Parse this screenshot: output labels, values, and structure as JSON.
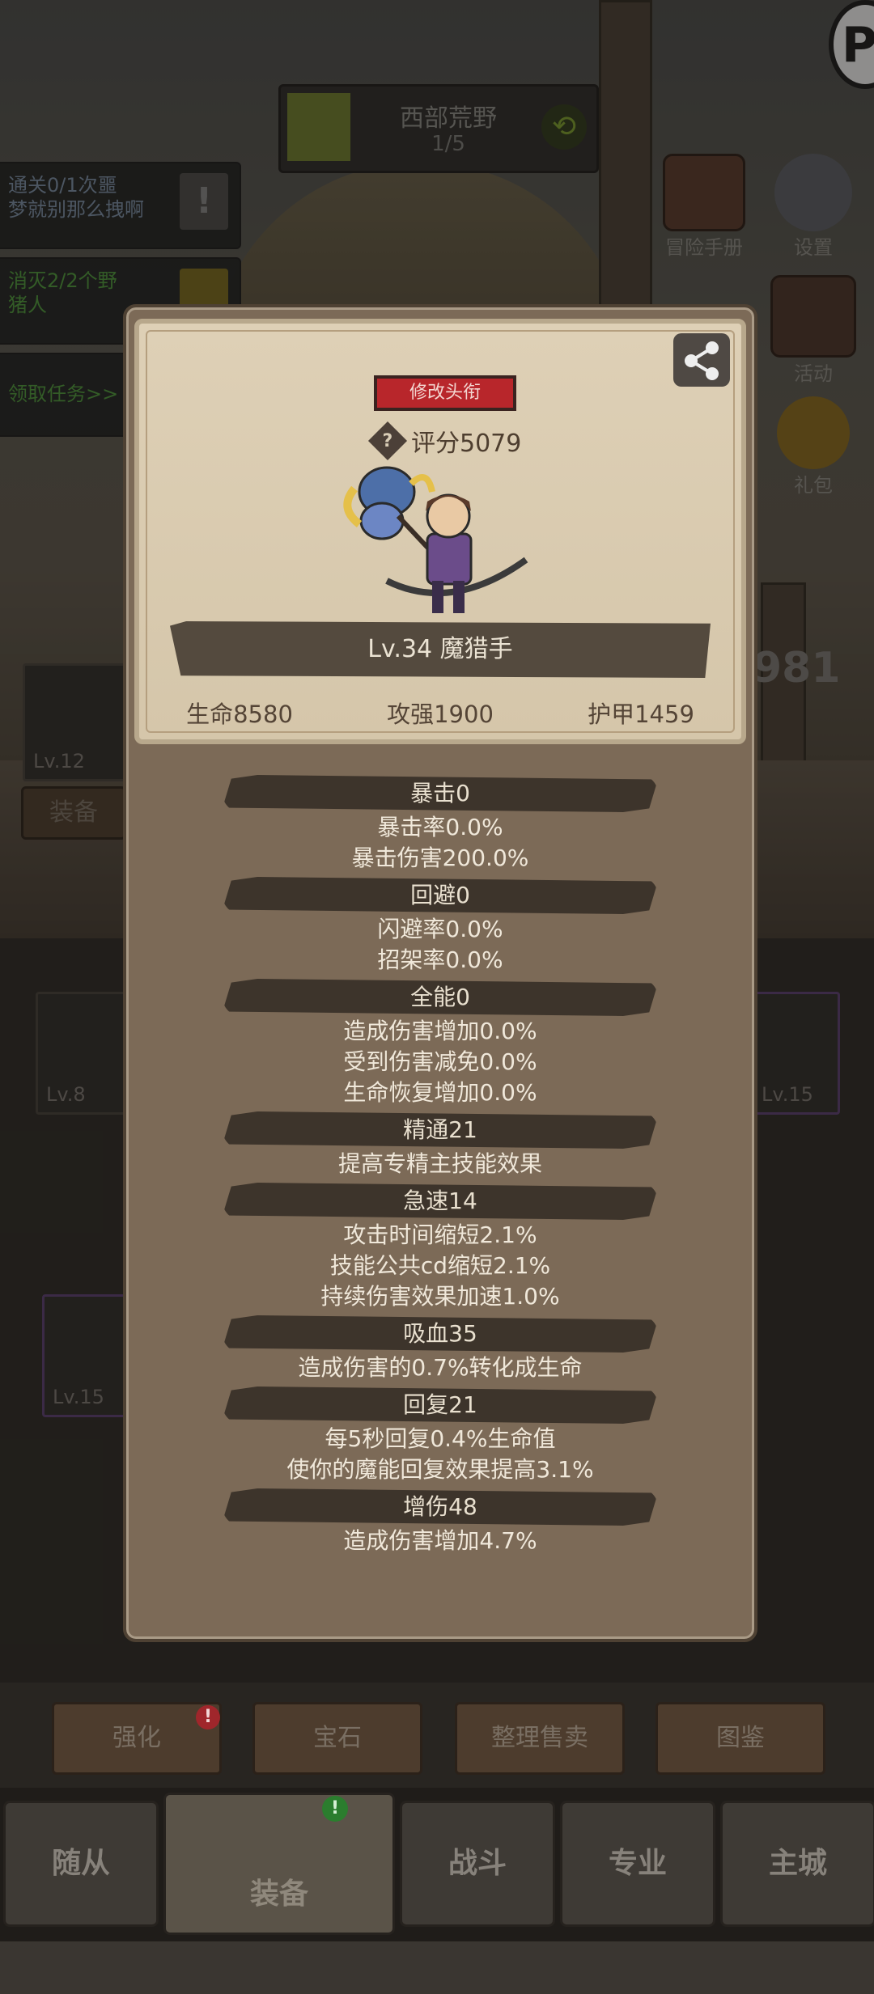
{
  "stage": {
    "name": "西部荒野",
    "progress": "1/5"
  },
  "quests": [
    {
      "line1": "通关0/1次噩",
      "line2": "梦就别那么拽啊",
      "color": "#7b8fa6",
      "button": "!"
    },
    {
      "line1": "消灭2/2个野",
      "line2": "猪人",
      "color": "#4e9a3b",
      "button": ""
    },
    {
      "line1": "领取任务>>",
      "line2": "",
      "color": "#4e9a3b",
      "button": ""
    }
  ],
  "side_menu": [
    {
      "label": "冒险手册",
      "icon": "book-icon"
    },
    {
      "label": "设置",
      "icon": "gear-icon"
    },
    {
      "label": "活动",
      "icon": "calendar-icon"
    },
    {
      "label": "礼包",
      "icon": "gift-coin-icon"
    }
  ],
  "corner_badge": "P",
  "background": {
    "score_fragment": "981",
    "equip_tab": "装备",
    "slot_levels": [
      "Lv.12",
      "Lv.8",
      "Lv.15",
      "Lv.15"
    ]
  },
  "profile": {
    "change_title_button": "修改头衔",
    "score": "评分5079",
    "help_symbol": "?",
    "level_name": "Lv.34 魔猎手",
    "stats": [
      "生命8580",
      "攻强1900",
      "护甲1459"
    ]
  },
  "attributes": [
    {
      "header": "暴击0",
      "lines": [
        "暴击率0.0%",
        "暴击伤害200.0%"
      ]
    },
    {
      "header": "回避0",
      "lines": [
        "闪避率0.0%",
        "招架率0.0%"
      ]
    },
    {
      "header": "全能0",
      "lines": [
        "造成伤害增加0.0%",
        "受到伤害减免0.0%",
        "生命恢复增加0.0%"
      ]
    },
    {
      "header": "精通21",
      "lines": [
        "提高专精主技能效果"
      ]
    },
    {
      "header": "急速14",
      "lines": [
        "攻击时间缩短2.1%",
        "技能公共cd缩短2.1%",
        "持续伤害效果加速1.0%"
      ]
    },
    {
      "header": "吸血35",
      "lines": [
        "造成伤害的0.7%转化成生命"
      ]
    },
    {
      "header": "回复21",
      "lines": [
        "每5秒回复0.4%生命值",
        "使你的魔能回复效果提高3.1%"
      ]
    },
    {
      "header": "增伤48",
      "lines": [
        "造成伤害增加4.7%"
      ]
    }
  ],
  "bottom_buttons": [
    "强化",
    "宝石",
    "整理售卖",
    "图鉴"
  ],
  "nav": [
    "随从",
    "装备",
    "战斗",
    "专业",
    "主城"
  ],
  "badges": {
    "strengthen": "!",
    "equip": "!"
  },
  "colors": {
    "modal_bg": "#7c6a57",
    "card_bg": "#d9cbb0",
    "title_button": "#b8262b",
    "quest_green": "#4e9a3b"
  }
}
